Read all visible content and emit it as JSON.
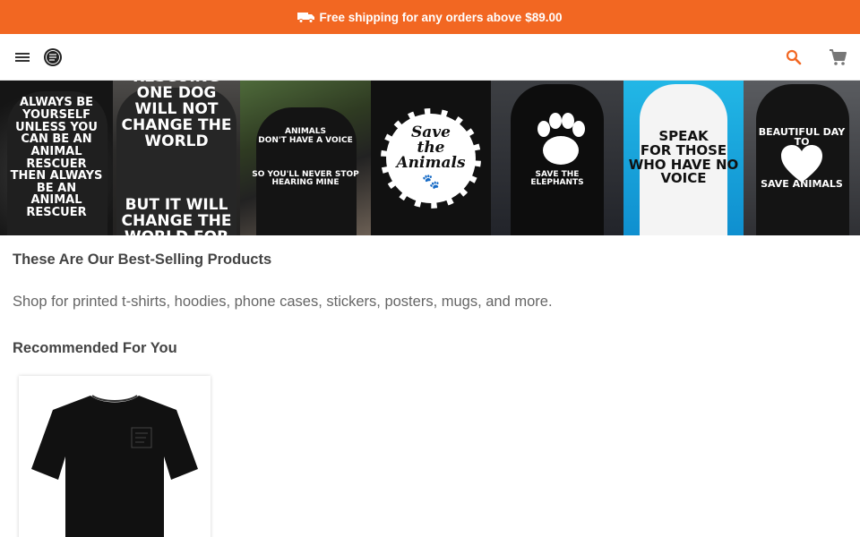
{
  "promo": {
    "text": "Free shipping for any orders above",
    "amount": "$89.00",
    "icon": "truck-icon"
  },
  "header": {
    "menu_icon": "menu-icon",
    "logo_icon": "brand-logo-icon",
    "search_icon": "search-icon",
    "cart_icon": "cart-icon"
  },
  "banner": {
    "panels": [
      {
        "text": "ALWAYS BE\nYOURSELF\nUNLESS YOU CAN BE AN\nANIMAL\nRESCUER\nTHEN ALWAYS BE AN\nANIMAL RESCUER"
      },
      {
        "text": "RESCUING\nONE DOG\nWILL NOT CHANGE THE WORLD\n\n\n\nBUT IT WILL CHANGE THE WORLD FOR"
      },
      {
        "text": "ANIMALS\nDON'T HAVE A VOICE\n\n\n\nSO YOU'LL NEVER STOP\nHEARING MINE"
      },
      {
        "text": "Save\nthe\nAnimals"
      },
      {
        "text": "\n\n\n\n\nSAVE THE\nELEPHANTS"
      },
      {
        "text": "SPEAK\nFOR THOSE WHO HAVE NO\nVOICE"
      },
      {
        "text": "BEAUTIFUL DAY\nTO\n\n\n\nSAVE ANIMALS"
      }
    ]
  },
  "sections": {
    "bestselling_heading": "These Are Our Best-Selling Products",
    "subtext": "Shop for printed t-shirts, hoodies, phone cases, stickers, posters, mugs, and more.",
    "recommended_heading": "Recommended For You"
  },
  "products": [
    {
      "image": "black t-shirt",
      "color": "#111111"
    }
  ],
  "colors": {
    "accent": "#f26722",
    "heading": "#444444",
    "body_text": "#666666"
  }
}
